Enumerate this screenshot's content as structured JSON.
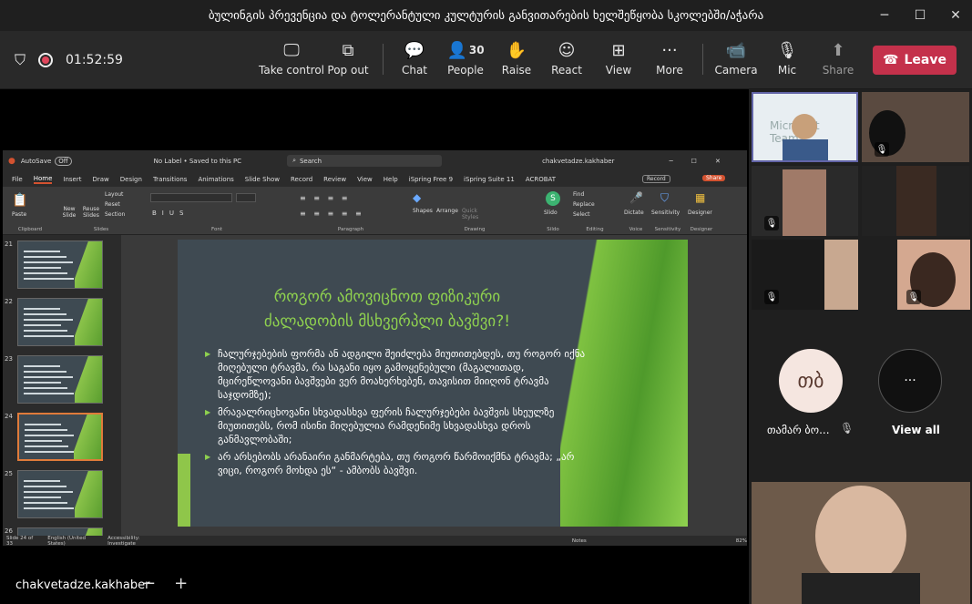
{
  "window": {
    "title": "ბულინგის პრევენცია და ტოლერანტული კულტურის განვითარების ხელშეწყობა სკოლებში/აჭარა"
  },
  "meeting": {
    "timer": "01:52:59",
    "people_count": "30"
  },
  "toolbar": {
    "take_control": "Take control",
    "pop_out": "Pop out",
    "chat": "Chat",
    "people": "People",
    "raise": "Raise",
    "react": "React",
    "view": "View",
    "more": "More",
    "camera": "Camera",
    "mic": "Mic",
    "share": "Share",
    "leave": "Leave"
  },
  "share": {
    "presenter": "chakvetadze.kakhaber"
  },
  "ppt": {
    "autosave": "AutoSave",
    "autosave_state": "Off",
    "doc_status": "No Label • Saved to this PC",
    "search": "Search",
    "user": "chakvetadze.kakhaber",
    "record": "Record",
    "share": "Share",
    "tabs": [
      "File",
      "Home",
      "Insert",
      "Draw",
      "Design",
      "Transitions",
      "Animations",
      "Slide Show",
      "Record",
      "Review",
      "View",
      "Help",
      "iSpring Free 9",
      "iSpring Suite 11",
      "ACROBAT"
    ],
    "active_tab": "Home",
    "groups": [
      "Clipboard",
      "Slides",
      "Font",
      "Paragraph",
      "Drawing",
      "Sildo",
      "Editing",
      "Voice",
      "Sensitivity",
      "Designer"
    ],
    "buttons": {
      "paste": "Paste",
      "new_slide": "New Slide",
      "reuse": "Reuse Slides",
      "layout": "Layout",
      "reset": "Reset",
      "section": "Section",
      "shapes": "Shapes",
      "arrange": "Arrange",
      "quick_styles": "Quick Styles",
      "find": "Find",
      "replace": "Replace",
      "select": "Select",
      "dictate": "Dictate",
      "sensitivity": "Sensitivity",
      "designer": "Designer",
      "slido": "Slido"
    },
    "thumbs": [
      "21",
      "22",
      "23",
      "24",
      "25",
      "26"
    ],
    "selected_thumb": "24",
    "status": {
      "slide": "Slide 24 of 33",
      "lang": "English (United States)",
      "access": "Accessibility: Investigate",
      "notes": "Notes",
      "zoom": "82%"
    }
  },
  "slide": {
    "title_line1": "როგორ ამოვიცნოთ ფიზიკური",
    "title_line2": "ძალადობის მსხვერპლი ბავშვი?!",
    "bullets": [
      "ჩალურჯებების ფორმა ან ადგილი შეიძლება მიუთითებდეს, თუ როგორ იქნა მიღებული ტრავმა, რა საგანი იყო გამოყენებული (მაგალითად, მცირეწლოვანი ბავშვები ვერ მოახერხებენ, თავისით მიიღონ ტრავმა საჯდომზე);",
      "მრავალრიცხოვანი სხვადასხვა ფერის ჩალურჯებები ბავშვის სხეულზე მიუთითებს, რომ ისინი მიღებულია რამდენიმე სხვადასხვა დროს განმავლობაში;",
      "არ არსებობს არანაირი განმარტება, თუ როგორ წარმოიქმნა ტრავმა; „არ ვიცი, როგორ მოხდა ეს“ - ამბობს ბავშვი."
    ]
  },
  "participants": {
    "tile1_label": "Microsoft Teams",
    "avatar_initials": "თბ",
    "avatar_name": "თამარ ბო...",
    "view_all": "View all"
  }
}
